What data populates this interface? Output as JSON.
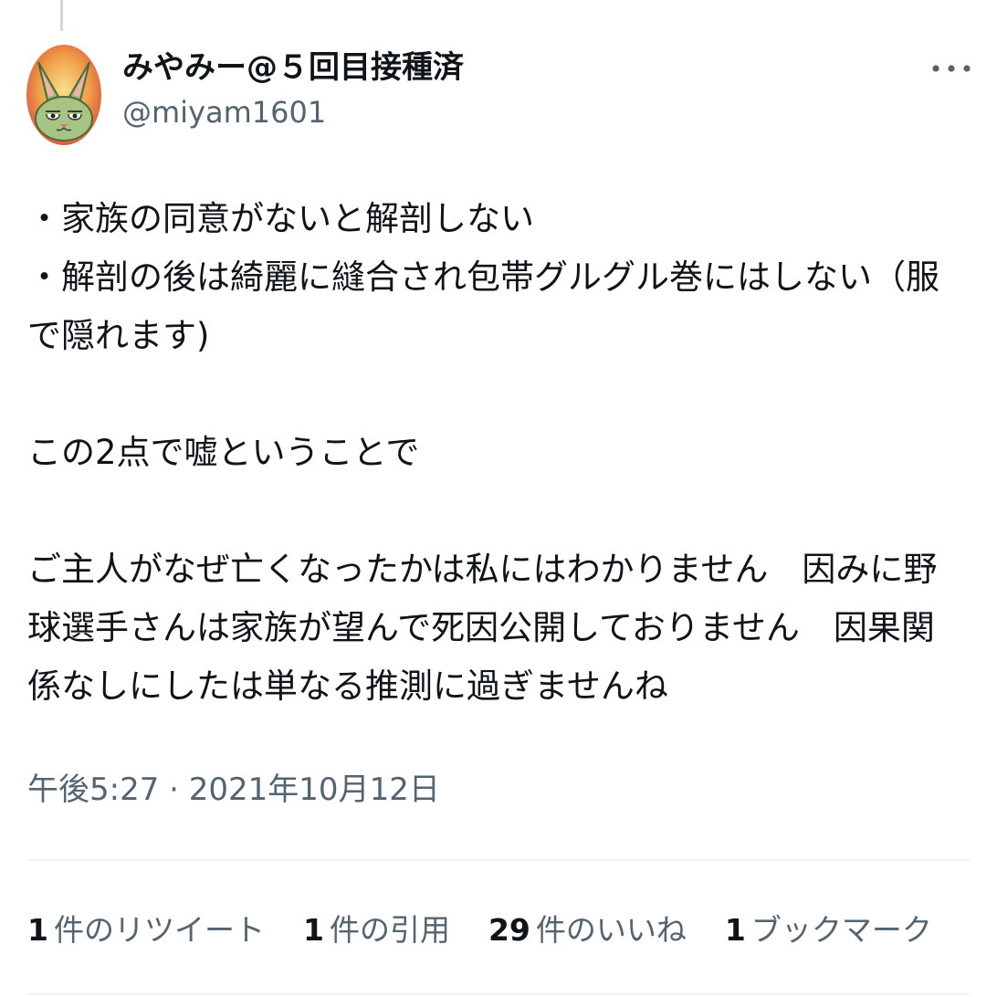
{
  "author": {
    "display_name": "みやみー@５回目接種済",
    "handle": "@miyam1601",
    "avatar_icon": "cat-avatar-icon"
  },
  "tweet": {
    "lines": [
      "・家族の同意がないと解剖しない",
      "・解剖の後は綺麗に縫合され包帯グルグル巻にはしない（服で隠れます)",
      "",
      "この2点で嘘ということで",
      "",
      "ご主人がなぜ亡くなったかは私にはわかりません　因みに野球選手さんは家族が望んで死因公開しておりません　因果関係なしにしたは単なる推測に過ぎませんね"
    ],
    "timestamp": "午後5:27 · 2021年10月12日"
  },
  "stats": {
    "retweets_count": "1",
    "retweets_label": "件のリツイート",
    "quotes_count": "1",
    "quotes_label": "件の引用",
    "likes_count": "29",
    "likes_label": "件のいいね",
    "bookmarks_count": "1",
    "bookmarks_label": "ブックマーク"
  },
  "menu": {
    "more_icon": "more-dots-icon"
  },
  "colors": {
    "text_primary": "#0f1419",
    "text_secondary": "#536471",
    "divider": "#eff3f4",
    "thread_line": "#cfd9de"
  }
}
